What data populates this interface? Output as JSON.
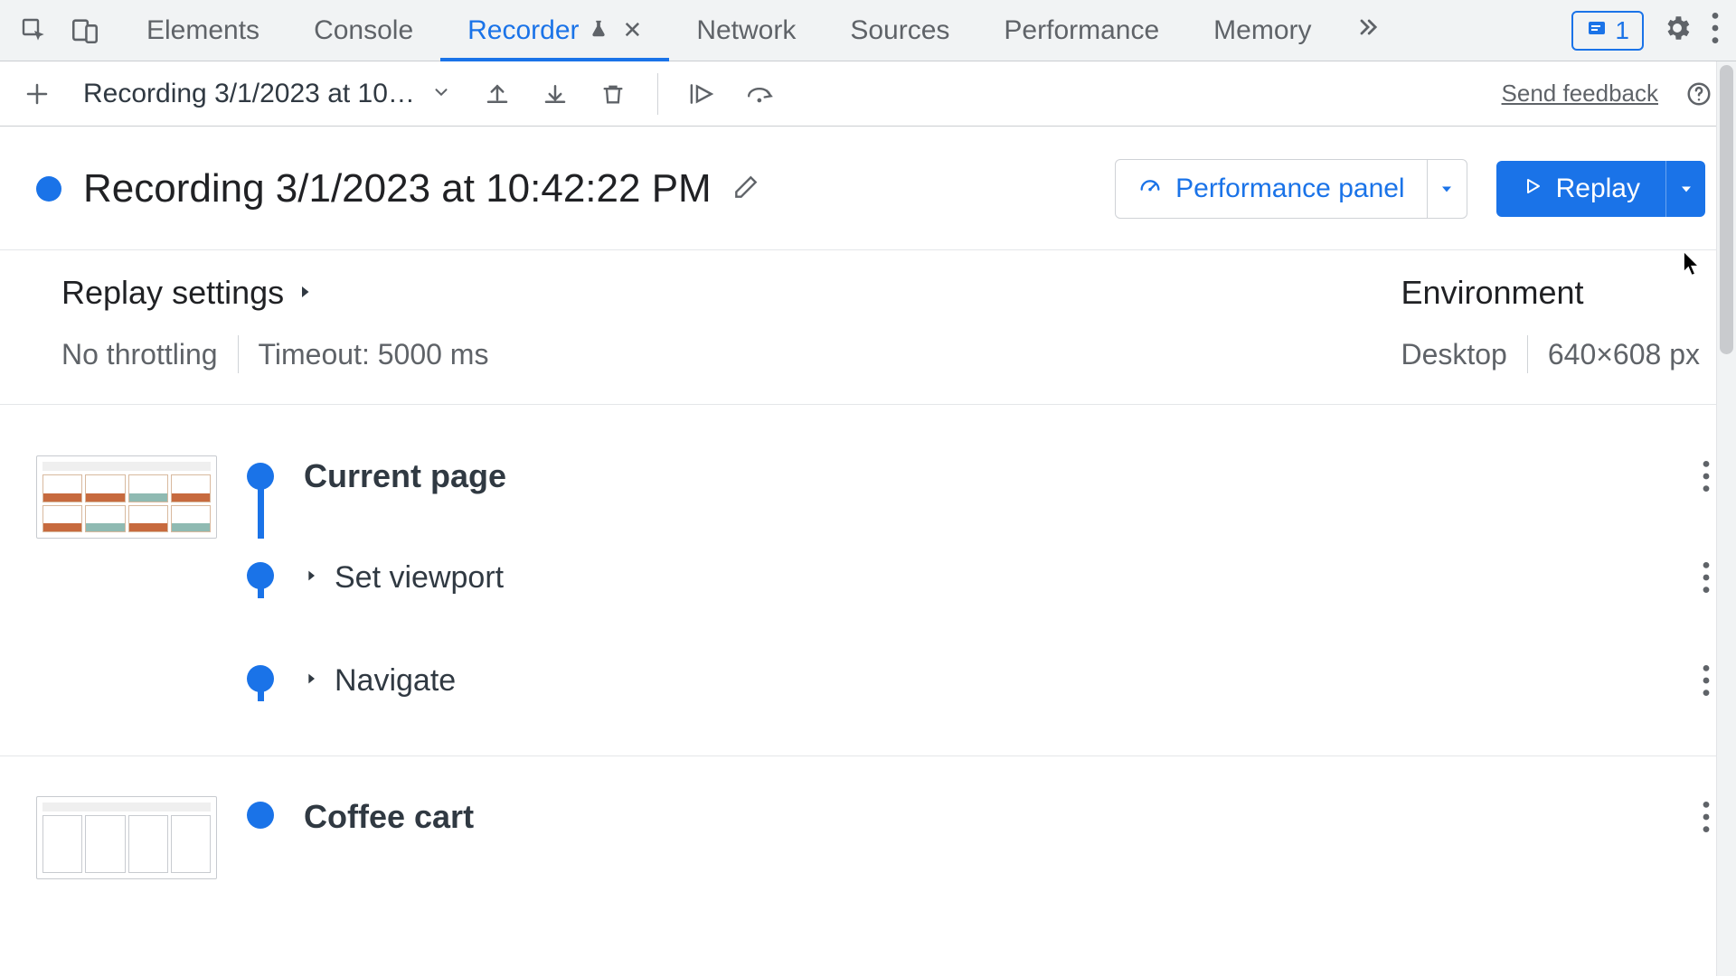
{
  "tabs": {
    "elements": "Elements",
    "console": "Console",
    "recorder": "Recorder",
    "network": "Network",
    "sources": "Sources",
    "performance": "Performance",
    "memory": "Memory"
  },
  "issues_count": "1",
  "toolbar": {
    "recording_selector": "Recording 3/1/2023 at 10…",
    "feedback": "Send feedback"
  },
  "recording": {
    "title": "Recording 3/1/2023 at 10:42:22 PM"
  },
  "perf_panel_label": "Performance panel",
  "replay_label": "Replay",
  "replay_settings": {
    "heading": "Replay settings",
    "throttling": "No throttling",
    "timeout": "Timeout: 5000 ms"
  },
  "environment": {
    "heading": "Environment",
    "device": "Desktop",
    "viewport": "640×608 px"
  },
  "steps": {
    "current_page": "Current page",
    "set_viewport": "Set viewport",
    "navigate": "Navigate",
    "coffee_cart": "Coffee cart"
  }
}
